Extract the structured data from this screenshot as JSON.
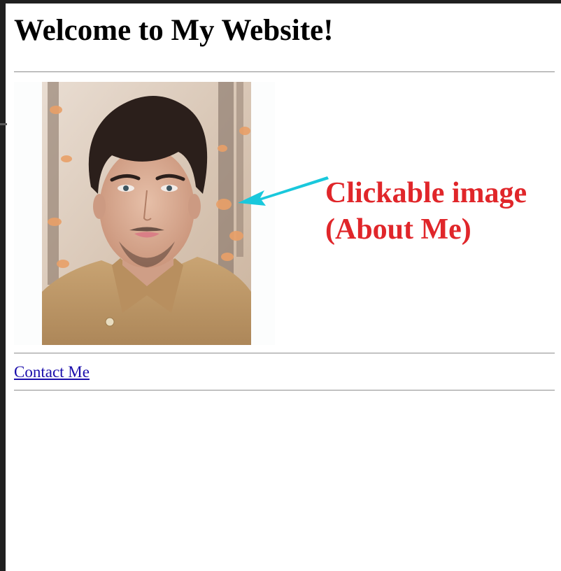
{
  "page": {
    "title": "Welcome to My Website!",
    "contact_link_label": "Contact Me",
    "image_link": {
      "alt": "About Me"
    }
  },
  "annotation": {
    "line1": "Clickable image",
    "line2": "(About Me)",
    "color": "#e0262a",
    "arrow_color": "#19c8dc"
  },
  "colors": {
    "link": "#1a0dab",
    "rule": "#9a9a9a",
    "frame": "#202020"
  }
}
